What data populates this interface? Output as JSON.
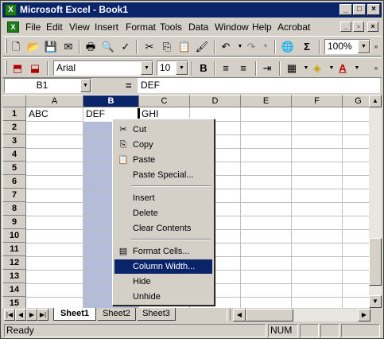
{
  "window": {
    "title": "Microsoft Excel - Book1",
    "app_icon": "excel-icon"
  },
  "menubar": {
    "items": [
      "File",
      "Edit",
      "View",
      "Insert",
      "Format",
      "Tools",
      "Data",
      "Window",
      "Help",
      "Acrobat"
    ]
  },
  "toolbar1": {
    "zoom": "100%"
  },
  "toolbar2": {
    "font": "Arial",
    "size": "10"
  },
  "formula_bar": {
    "name_box": "B1",
    "eq": "=",
    "value": "DEF"
  },
  "grid": {
    "columns": [
      "A",
      "B",
      "C",
      "D",
      "E",
      "F",
      "G"
    ],
    "rows": [
      "1",
      "2",
      "3",
      "4",
      "5",
      "6",
      "7",
      "8",
      "9",
      "10",
      "11",
      "12",
      "13",
      "14",
      "15"
    ],
    "cells": {
      "A1": "ABC",
      "B1": "DEF",
      "C1": "GHI"
    },
    "selected_column": "B"
  },
  "context_menu": {
    "items": [
      {
        "label": "Cut",
        "icon": "scissors-icon"
      },
      {
        "label": "Copy",
        "icon": "copy-icon"
      },
      {
        "label": "Paste",
        "icon": "paste-icon"
      },
      {
        "label": "Paste Special..."
      },
      {
        "label": "Insert"
      },
      {
        "label": "Delete"
      },
      {
        "label": "Clear Contents"
      },
      {
        "label": "Format Cells...",
        "icon": "format-cells-icon"
      },
      {
        "label": "Column Width...",
        "highlighted": true
      },
      {
        "label": "Hide"
      },
      {
        "label": "Unhide"
      }
    ]
  },
  "sheets": {
    "tabs": [
      "Sheet1",
      "Sheet2",
      "Sheet3"
    ],
    "active": "Sheet1"
  },
  "status": {
    "text": "Ready",
    "num": "NUM"
  },
  "colors": {
    "title_bar": "#0a246a",
    "selection": "#b3bcd9",
    "menu_highlight": "#0a246a",
    "chrome": "#d4d0c8"
  }
}
